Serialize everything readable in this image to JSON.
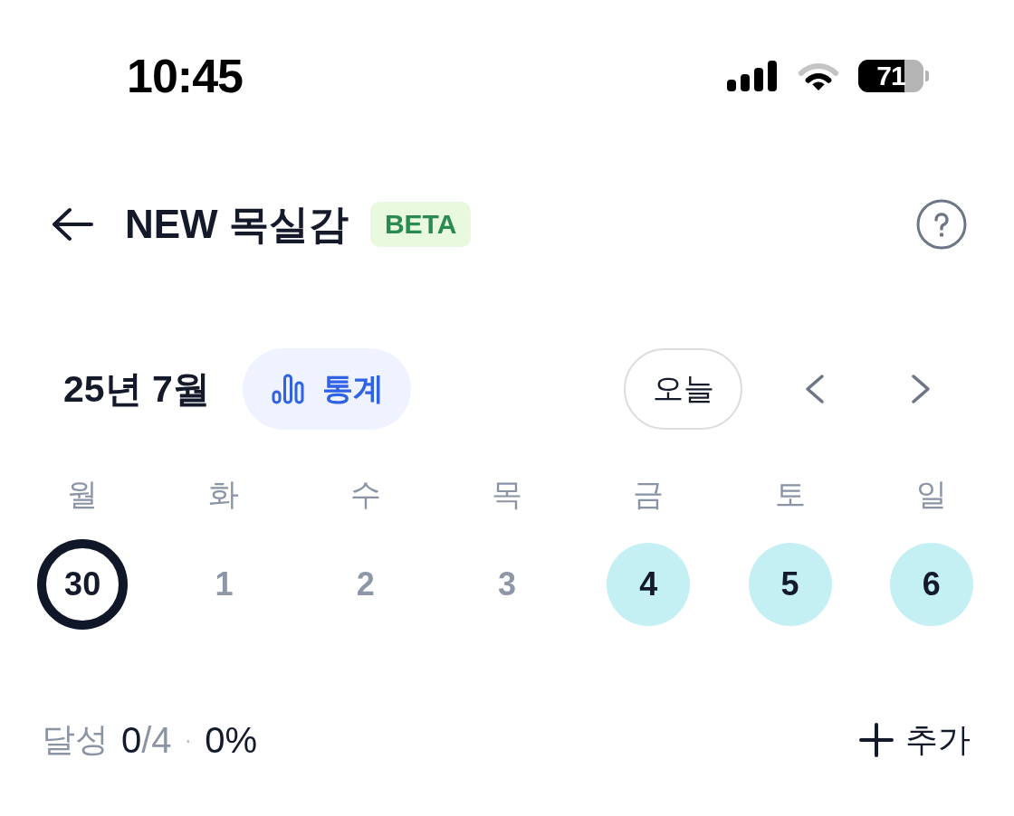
{
  "status_bar": {
    "time": "10:45",
    "battery_text": "71"
  },
  "header": {
    "title": "NEW 목실감",
    "badge": "BETA"
  },
  "calendar": {
    "month": "25년 7월",
    "stats_button": "통계",
    "today_button": "오늘",
    "weekdays": [
      "월",
      "화",
      "수",
      "목",
      "금",
      "토",
      "일"
    ],
    "days": [
      {
        "label": "30",
        "selected": true,
        "marked": false
      },
      {
        "label": "1",
        "selected": false,
        "marked": false
      },
      {
        "label": "2",
        "selected": false,
        "marked": false
      },
      {
        "label": "3",
        "selected": false,
        "marked": false
      },
      {
        "label": "4",
        "selected": false,
        "marked": true
      },
      {
        "label": "5",
        "selected": false,
        "marked": true
      },
      {
        "label": "6",
        "selected": false,
        "marked": true
      }
    ]
  },
  "progress": {
    "label": "달성",
    "done": "0",
    "total": "/4",
    "separator": "·",
    "percent": "0%",
    "add_button": "추가"
  }
}
